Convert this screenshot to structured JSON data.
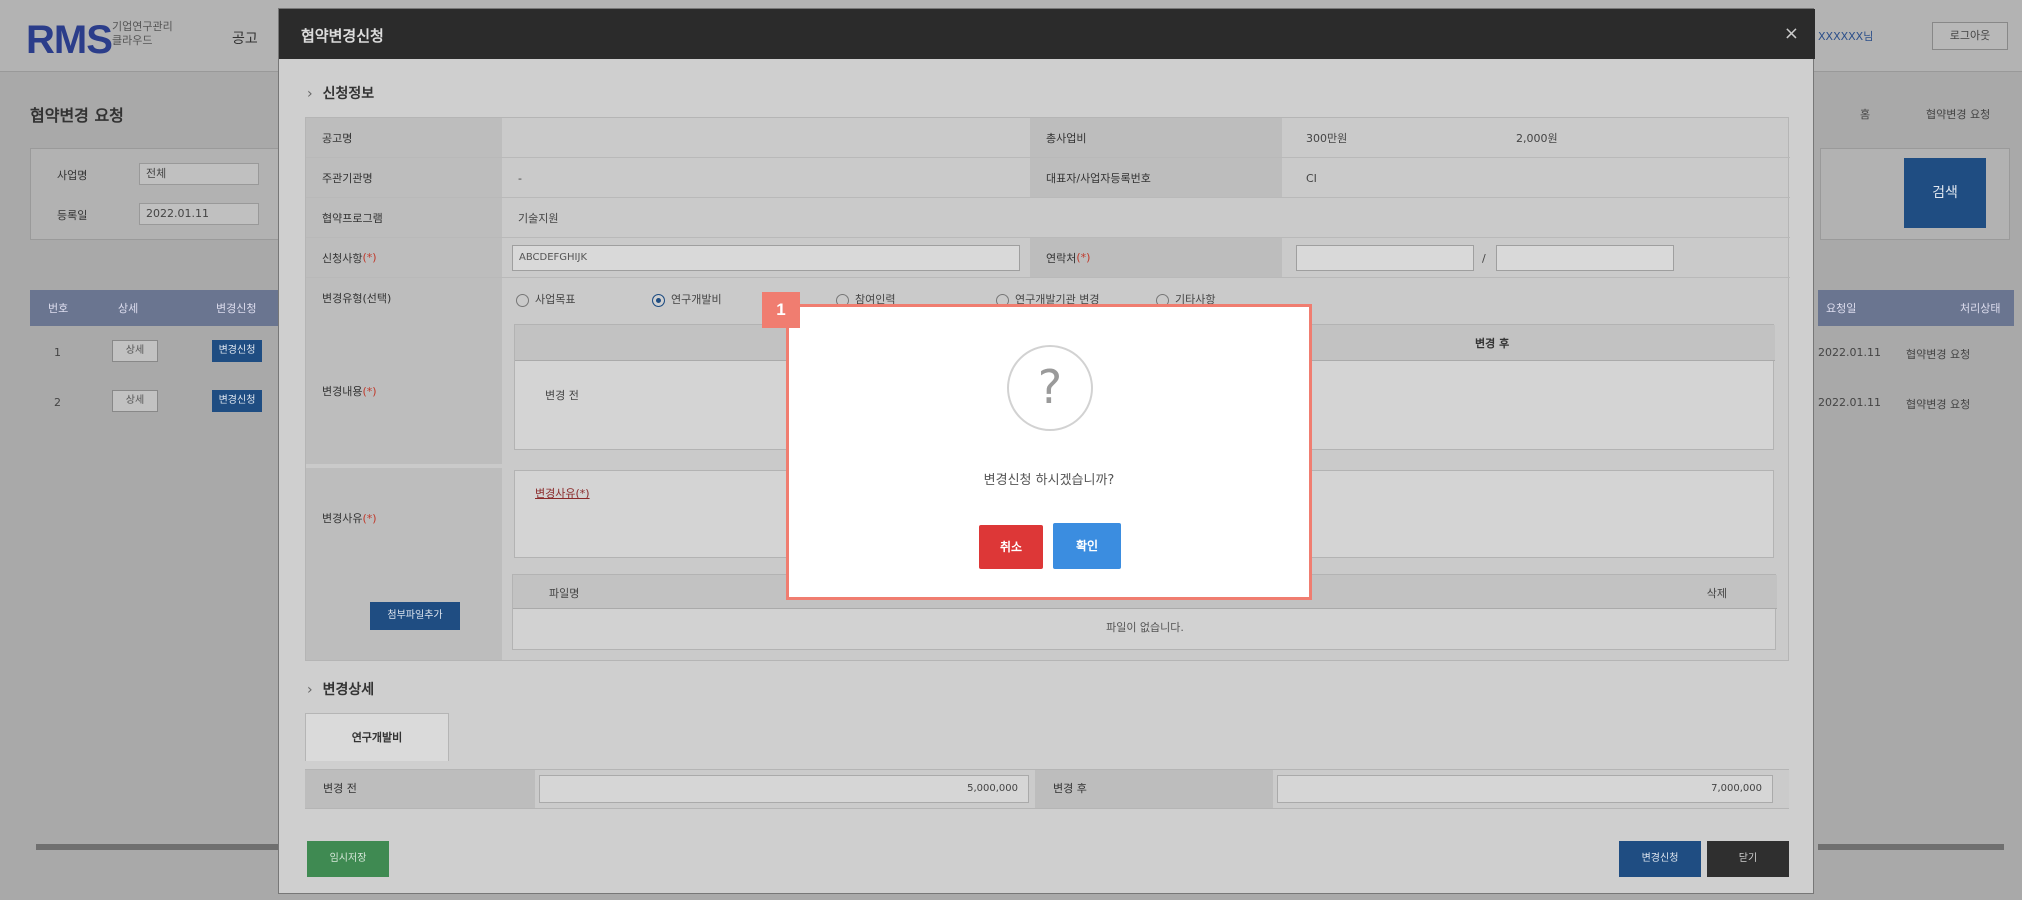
{
  "background": {
    "logo": "RMS",
    "logo_sub": "기업연구관리\n클라우드",
    "menu_first": "공고",
    "page_title": "협약변경 요청",
    "right_link": "XXXXXX님",
    "right_button": "로그아웃",
    "crumb_home": "홈",
    "crumb_page": "협약변경 요청",
    "search": {
      "label1": "사업명",
      "value1": "전체",
      "label2": "등록일",
      "value2": "2022.01.11",
      "button": "검색"
    },
    "grid": {
      "headers_left": [
        "번호",
        "상세",
        "변경신청"
      ],
      "headers_right": [
        "요청일",
        "처리상태"
      ],
      "rows": [
        {
          "no": "1",
          "detail": "상세",
          "action": "변경신청",
          "date": "2022.01.11",
          "status": "협약변경 요청"
        },
        {
          "no": "2",
          "detail": "상세",
          "action": "변경신청",
          "date": "2022.01.11",
          "status": "협약변경 요청"
        }
      ]
    }
  },
  "modal": {
    "title": "협약변경신청",
    "close": "×",
    "section1_title": "신청정보",
    "fields": {
      "notice_label": "공고명",
      "budget_label": "총사업비",
      "budget_value_1": "300만원",
      "budget_value_2": "2,000원",
      "org_label": "주관기관명",
      "org_value": "-",
      "ceo_label": "대표자/사업자등록번호",
      "ceo_value": "CI",
      "program_label": "협약프로그램",
      "program_value": "기술지원",
      "applicant_label": "신청사항",
      "applicant_value": "ABCDEFGHIJK",
      "contact_label": "연락처",
      "contact_sep": "/",
      "change_type_label": "변경유형(선택)",
      "change_content_label": "변경내용",
      "reason_label": "변경사유",
      "reason_text": "변경사유(*)",
      "file_button": "첨부파일추가",
      "file_col1": "파일명",
      "file_col2": "삭제",
      "file_empty": "파일이 없습니다.",
      "change_before": "변경 전",
      "change_after": "변경 후"
    },
    "radios": [
      {
        "label": "사업목표",
        "checked": false
      },
      {
        "label": "연구개발비",
        "checked": true
      },
      {
        "label": "참여인력",
        "checked": false
      },
      {
        "label": "연구개발기관 변경",
        "checked": false
      },
      {
        "label": "기타사항",
        "checked": false
      }
    ],
    "section2_title": "변경상세",
    "tab_label": "연구개발비",
    "detail": {
      "before_label": "변경 전",
      "before_value": "5,000,000",
      "after_label": "변경 후",
      "after_value": "7,000,000"
    },
    "buttons": {
      "temp_save": "임시저장",
      "apply": "변경신청",
      "close": "닫기"
    }
  },
  "confirm": {
    "icon": "?",
    "message": "변경신청 하시겠습니까?",
    "cancel": "취소",
    "ok": "확인"
  },
  "marker": "1",
  "colors": {
    "highlight": "#f07d70",
    "ok_button": "#3b8de0",
    "cancel_button": "#dd3737",
    "primary_dark": "#1f4d82"
  }
}
